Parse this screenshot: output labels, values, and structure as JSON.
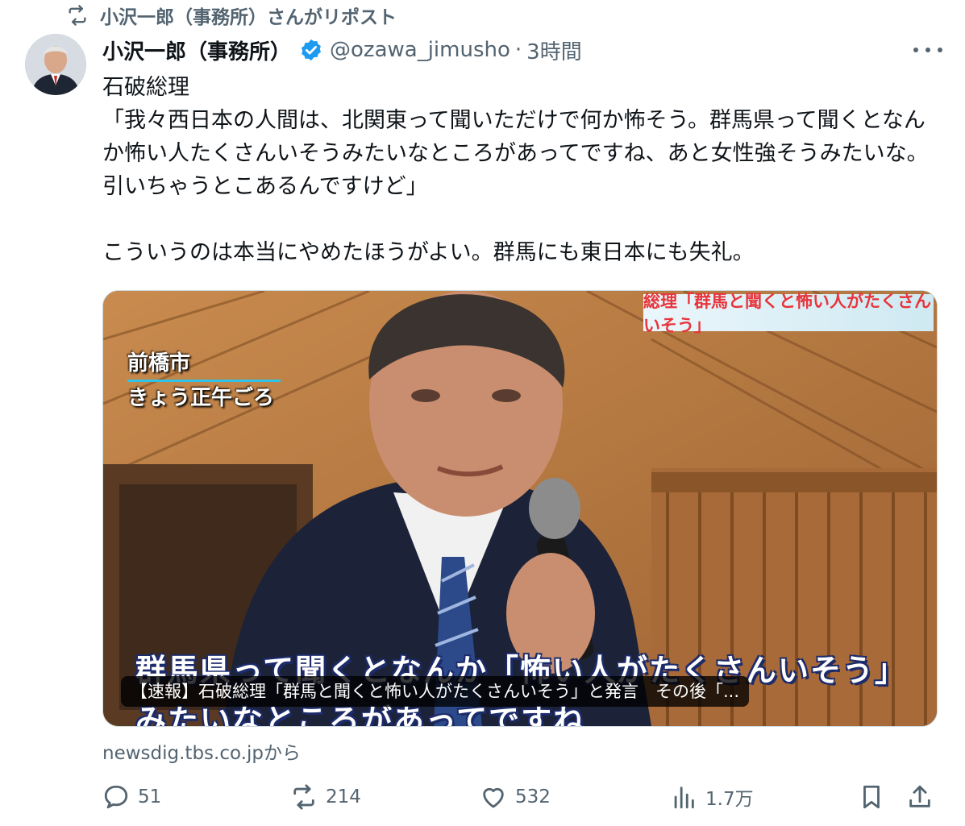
{
  "repost_notice": "小沢一郎（事務所）さんがリポスト",
  "author": {
    "display_name": "小沢一郎（事務所）",
    "handle": "@ozawa_jimusho",
    "separator": "·",
    "time": "3時間",
    "verified_color": "#1d9bf0"
  },
  "tweet": {
    "text": "石破総理\n「我々西日本の人間は、北関東って聞いただけで何か怖そう。群馬県って聞くとなんか怖い人たくさんいそうみたいなところがあってですね、あと女性強そうみたいな。引いちゃうとこあるんですけど」\n\nこういうのは本当にやめたほうがよい。群馬にも東日本にも失礼。"
  },
  "media": {
    "banner": "総理「群馬と聞くと怖い人がたくさんいそう」",
    "location_line1": "前橋市",
    "location_line2": "きょう正午ごろ",
    "caption_line1": "群馬県って聞くとなんか「怖い人がたくさんいそう」",
    "caption_line2": "みたいなところがあってですね",
    "card_title": "【速報】石破総理「群馬と聞くと怖い人がたくさんいそう」と発言　その後「..."
  },
  "link_source": "newsdig.tbs.co.jpから",
  "actions": {
    "replies": "51",
    "reposts": "214",
    "likes": "532",
    "views": "1.7万"
  },
  "icons": {
    "repost": "repost-icon",
    "verified": "verified-badge-icon",
    "more": "more-icon",
    "reply": "reply-icon",
    "like": "heart-icon",
    "views": "views-icon",
    "bookmark": "bookmark-icon",
    "share": "share-icon"
  }
}
